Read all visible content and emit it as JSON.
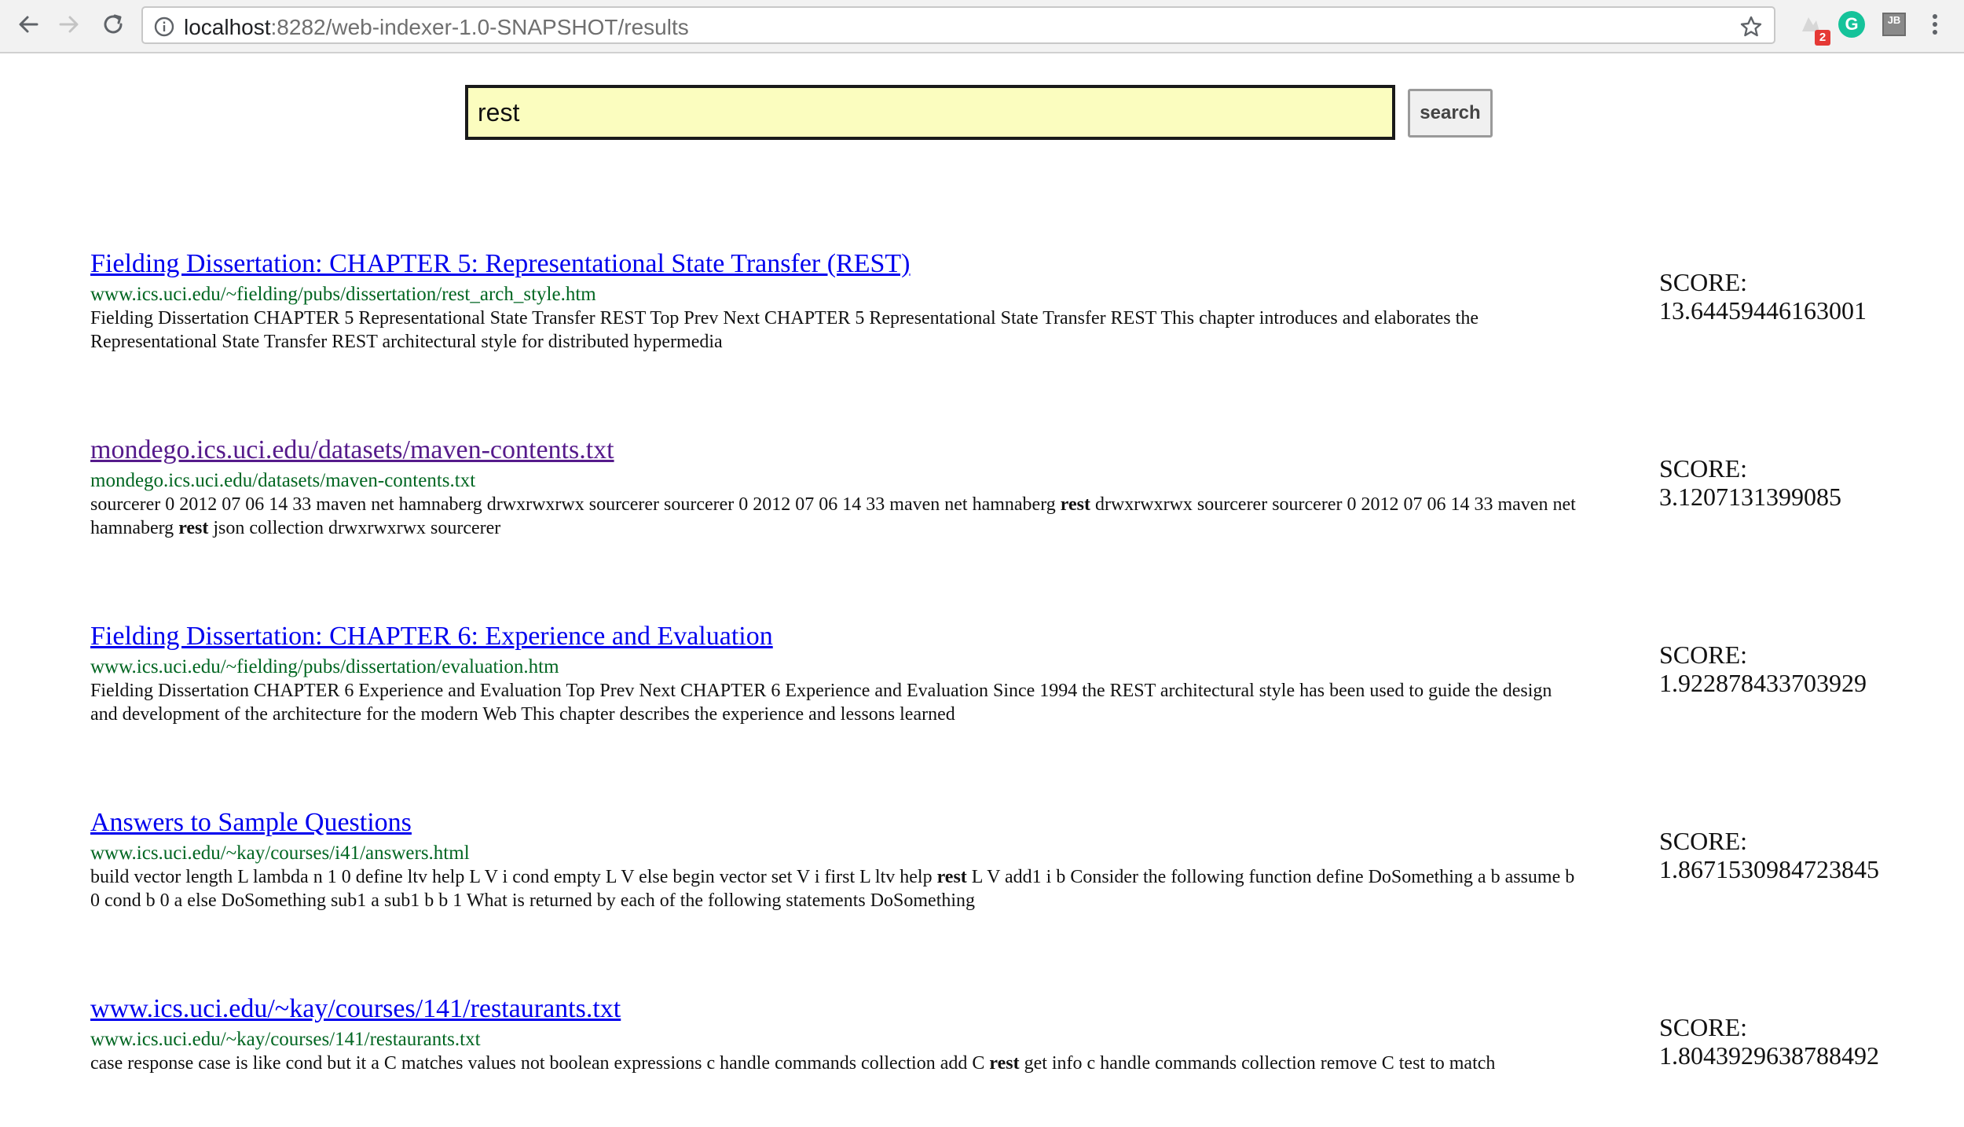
{
  "browser": {
    "url_host": "localhost",
    "url_path": ":8282/web-indexer-1.0-SNAPSHOT/results",
    "extension_badge": "2",
    "grammarly_label": "G",
    "jb_label": "JB"
  },
  "search": {
    "query": "rest",
    "button_label": "search"
  },
  "results": [
    {
      "title": "Fielding Dissertation: CHAPTER 5: Representational State Transfer (REST)",
      "url": "www.ics.uci.edu/~fielding/pubs/dissertation/rest_arch_style.htm",
      "snippet": "Fielding Dissertation CHAPTER 5 Representational State Transfer REST Top Prev Next CHAPTER 5 Representational State Transfer REST This chapter introduces and elaborates the Representational State Transfer REST architectural style for distributed hypermedia",
      "score_label": "SCORE:",
      "score": "13.64459446163001",
      "visited": false
    },
    {
      "title": "mondego.ics.uci.edu/datasets/maven-contents.txt",
      "url": "mondego.ics.uci.edu/datasets/maven-contents.txt",
      "snippet": "sourcerer 0 2012 07 06 14 33 maven net hamnaberg drwxrwxrwx sourcerer sourcerer 0 2012 07 06 14 33 maven net hamnaberg <b>rest</b> drwxrwxrwx sourcerer sourcerer 0 2012 07 06 14 33 maven net hamnaberg <b>rest</b> json collection drwxrwxrwx sourcerer",
      "score_label": "SCORE:",
      "score": "3.1207131399085",
      "visited": true
    },
    {
      "title": "Fielding Dissertation: CHAPTER 6: Experience and Evaluation",
      "url": "www.ics.uci.edu/~fielding/pubs/dissertation/evaluation.htm",
      "snippet": "Fielding Dissertation CHAPTER 6 Experience and Evaluation Top Prev Next CHAPTER 6 Experience and Evaluation Since 1994 the REST architectural style has been used to guide the design and development of the architecture for the modern Web This chapter describes the experience and lessons learned",
      "score_label": "SCORE:",
      "score": "1.922878433703929",
      "visited": false
    },
    {
      "title": "Answers to Sample Questions",
      "url": "www.ics.uci.edu/~kay/courses/i41/answers.html",
      "snippet": "build vector length L lambda n 1 0 define ltv help L V i cond empty L V else begin vector set V i first L ltv help <b>rest</b> L V add1 i b Consider the following function define DoSomething a b assume b 0 cond b 0 a else DoSomething sub1 a sub1 b b 1 What is returned by each of the following statements DoSomething",
      "score_label": "SCORE:",
      "score": "1.8671530984723845",
      "visited": false
    },
    {
      "title": "www.ics.uci.edu/~kay/courses/141/restaurants.txt",
      "url": "www.ics.uci.edu/~kay/courses/141/restaurants.txt",
      "snippet": "case response case is like cond but it a C matches values not boolean expressions c handle commands collection add C <b>rest</b> get info c handle commands collection remove C test to match",
      "score_label": "SCORE:",
      "score": "1.8043929638788492",
      "visited": false
    }
  ]
}
